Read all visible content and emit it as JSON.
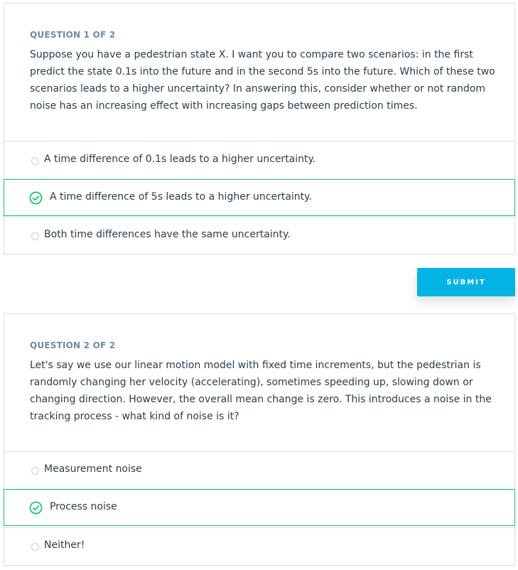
{
  "questions": [
    {
      "label": "QUESTION 1 OF 2",
      "text": "Suppose you have a pedestrian state X. I want you to compare two scenarios: in the first predict the state 0.1s into the future and in the second 5s into the future. Which of these two scenarios leads to a higher uncertainty? In answering this, consider whether or not random noise has an increasing effect with increasing gaps between prediction times.",
      "options": [
        {
          "label": "A time difference of 0.1s leads to a higher uncertainty.",
          "selected": false
        },
        {
          "label": "A time difference of 5s leads to a higher uncertainty.",
          "selected": true
        },
        {
          "label": "Both time differences have the same uncertainty.",
          "selected": false
        }
      ]
    },
    {
      "label": "QUESTION 2 OF 2",
      "text": "Let's say we use our linear motion model with fixed time increments, but the pedestrian is randomly changing her velocity (accelerating), sometimes speeding up, slowing down or changing direction. However, the overall mean change is zero. This introduces a noise in the tracking process - what kind of noise is it?",
      "options": [
        {
          "label": "Measurement noise",
          "selected": false
        },
        {
          "label": "Process noise",
          "selected": true
        },
        {
          "label": "Neither!",
          "selected": false
        }
      ]
    }
  ],
  "submit": {
    "label": "SUBMIT"
  },
  "colors": {
    "accent": "#02b3e4",
    "correct": "#15c26b",
    "label": "#6f8aa3",
    "text": "#2e3d49",
    "border": "#dbe2e8"
  },
  "icons": {
    "selected": "check-circle-icon",
    "unselected": "radio-circle-icon"
  }
}
